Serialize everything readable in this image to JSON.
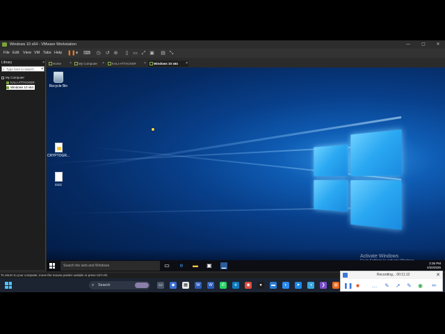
{
  "window": {
    "title": "Windows 10 x64 - VMware Workstation",
    "min": "—",
    "max": "▢",
    "close": "✕"
  },
  "menu": [
    "File",
    "Edit",
    "View",
    "VM",
    "Tabs",
    "Help"
  ],
  "toolbar_icons": [
    "pause-icon",
    "dropdown-icon",
    "send-keys-icon",
    "snapshot-icon",
    "revert-icon",
    "manage-snapshots-icon",
    "library-toggle-icon",
    "thumbnail-icon",
    "fullscreen-icon",
    "unity-icon",
    "console-icon",
    "view-icon"
  ],
  "tabs": [
    {
      "label": "Home",
      "active": false
    },
    {
      "label": "My Computer",
      "active": false
    },
    {
      "label": "KALI-ATTACKER",
      "active": false
    },
    {
      "label": "Windows 10 x64",
      "active": true
    }
  ],
  "library": {
    "title": "Library",
    "close": "×",
    "search_placeholder": "Type here to search",
    "tree": [
      {
        "label": "My Computer",
        "level": 0,
        "selected": false
      },
      {
        "label": "KALI-ATTACKER",
        "level": 1,
        "selected": false
      },
      {
        "label": "Windows 10 x64",
        "level": 1,
        "selected": true
      }
    ]
  },
  "desktop": {
    "icons": [
      {
        "label": "Recycle Bin",
        "kind": "recycle-bin"
      },
      {
        "label": "CRYPTOGR...",
        "kind": "file-yellow"
      },
      {
        "label": "cccc",
        "kind": "file-blank"
      }
    ],
    "activate_title": "Activate Windows",
    "activate_sub": "Go to Settings to activate Windows."
  },
  "guest_taskbar": {
    "search_placeholder": "Search the web and Windows",
    "time": "2:35 PM",
    "date": "4/20/2026"
  },
  "status_text": "To return to your computer, move the mouse pointer outside or press Ctrl+Alt.",
  "host_taskbar": {
    "search_label": "Search"
  },
  "recording": {
    "label": "Recording... 00:11:12",
    "close": "✕"
  },
  "colors": {
    "vmware_accent": "#7aa33c",
    "pause": "#f07a1e",
    "win_blue": "#1a8be0",
    "host_taskbar": "#1c2432"
  }
}
